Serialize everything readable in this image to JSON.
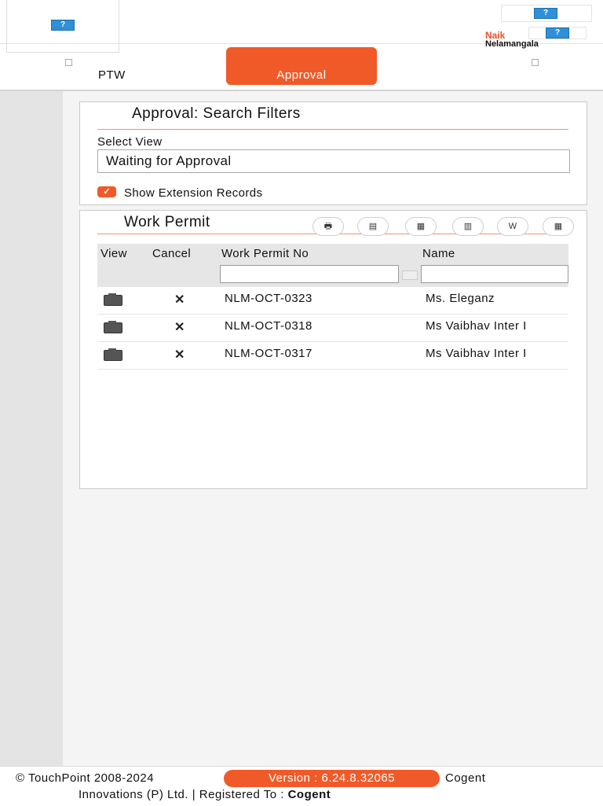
{
  "header": {
    "help_label": "?",
    "user_name": "Naik",
    "user_location": "Nelamangala"
  },
  "tabs": [
    {
      "label": "PTW"
    },
    {
      "label": "Approval"
    }
  ],
  "search_filters": {
    "title": "Approval: Search Filters",
    "select_view_label": "Select View",
    "select_view_value": "Waiting for Approval",
    "show_extension_label": "Show Extension Records",
    "show_extension_checked": true
  },
  "work_permit": {
    "title": "Work Permit",
    "toolbar_icons": [
      "print-icon",
      "pdf-icon",
      "csv-icon",
      "clipboard-icon",
      "word-icon",
      "calendar-icon"
    ],
    "columns": [
      "View",
      "Cancel",
      "Work Permit No",
      "Name"
    ],
    "rows": [
      {
        "permit_no": "NLM-OCT-0323",
        "name": "Ms. Eleganz"
      },
      {
        "permit_no": "NLM-OCT-0318",
        "name": "Ms Vaibhav Inter I"
      },
      {
        "permit_no": "NLM-OCT-0317",
        "name": "Ms Vaibhav Inter I"
      }
    ]
  },
  "footer": {
    "copyright": "© TouchPoint 2008-2024",
    "version": "Version : 6.24.8.32065",
    "company_part1": "Cogent",
    "company_part2": "Innovations (P) Ltd. | Registered To :",
    "registered_to": "Cogent"
  },
  "colors": {
    "accent": "#f05a28",
    "help_icon": "#2f8fd8"
  }
}
